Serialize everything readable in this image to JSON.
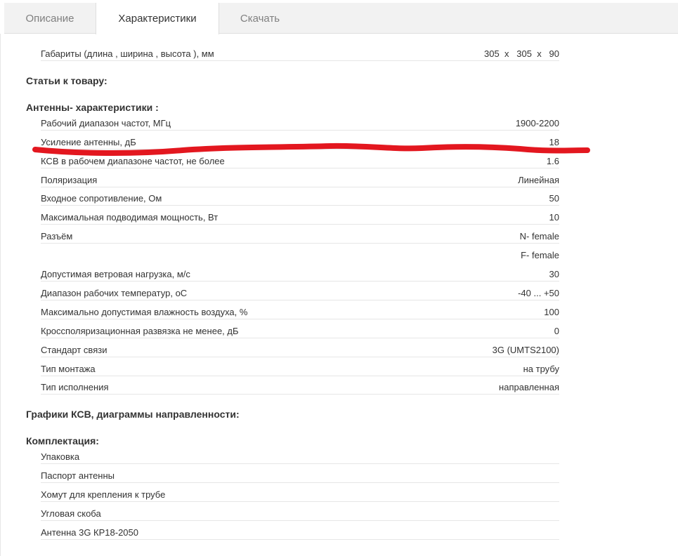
{
  "tabs": [
    {
      "label": "Описание",
      "active": false
    },
    {
      "label": "Характеристики",
      "active": true
    },
    {
      "label": "Скачать",
      "active": false
    }
  ],
  "dimensions_row": {
    "label": "Габариты (длина , ширина , высота ), мм",
    "value": "305  x   305  x   90"
  },
  "sections": {
    "articles": "Статьи к товару:",
    "antenna": "Антенны- характеристики :",
    "graphs": "Графики КСВ, диаграммы направленности:",
    "kit": "Комплектация:"
  },
  "specs": [
    {
      "label": "Рабочий диапазон частот, МГц",
      "value": "1900-2200"
    },
    {
      "label": "Усиление антенны, дБ",
      "value": "18"
    },
    {
      "label": "КСВ в рабочем диапазоне частот, не более",
      "value": "1.6"
    },
    {
      "label": "Поляризация",
      "value": "Линейная"
    },
    {
      "label": "Входное сопротивление, Ом",
      "value": "50"
    },
    {
      "label": "Максимальная подводимая мощность, Вт",
      "value": "10"
    },
    {
      "label": "Разъём",
      "value": "N- female"
    },
    {
      "label": "",
      "value": "F- female"
    },
    {
      "label": "Допустимая ветровая нагрузка, м/с",
      "value": "30"
    },
    {
      "label": "Диапазон рабочих температур, оС",
      "value": "-40 ... +50"
    },
    {
      "label": "Максимально допустимая влажность воздуха, %",
      "value": "100"
    },
    {
      "label": "Кроссполяризационная развязка не менее, дБ",
      "value": "0"
    },
    {
      "label": "Стандарт связи",
      "value": "3G (UMTS2100)"
    },
    {
      "label": "Тип монтажа",
      "value": "на трубу"
    },
    {
      "label": "Тип исполнения",
      "value": "направленная"
    }
  ],
  "kit": [
    {
      "label": "Упаковка"
    },
    {
      "label": "Паспорт антенны"
    },
    {
      "label": "Хомут для крепления к трубе"
    },
    {
      "label": "Угловая скоба"
    },
    {
      "label": "Антенна 3G КР18-2050"
    }
  ],
  "colors": {
    "tab_bar_bg": "#f2f2f2",
    "active_tab_bg": "#ffffff",
    "inactive_tab_text": "#808080",
    "text": "#333333",
    "row_line": "#e6e6e6",
    "highlight_mark": "#e3171f"
  }
}
